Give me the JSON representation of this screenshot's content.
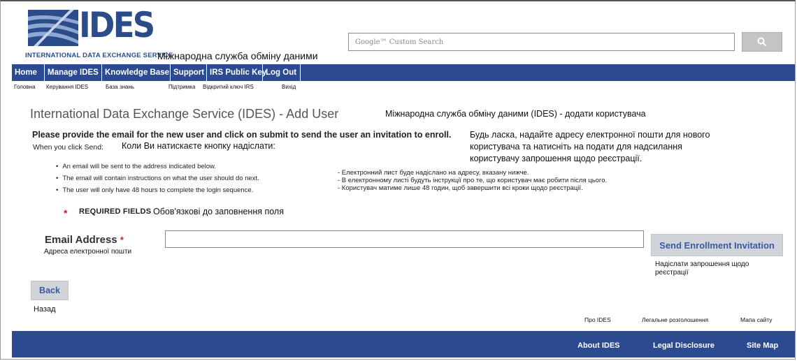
{
  "logo": {
    "big_text": "IDES",
    "sub_text": "INTERNATIONAL DATA EXCHANGE SERVICE",
    "uk_text": "Міжнародна служба обміну даними",
    "brand_color": "#2a4c8a"
  },
  "search": {
    "placeholder": "Google™ Custom Search",
    "button_icon": "search-icon"
  },
  "nav": {
    "items": [
      {
        "label": "Home",
        "uk": "Головна"
      },
      {
        "label": "Manage IDES",
        "uk": "Керування IDES"
      },
      {
        "label": "Knowledge Base",
        "uk": "База знань"
      },
      {
        "label": "Support",
        "uk": "Підтримка"
      },
      {
        "label": "IRS Public Key",
        "uk": "Відкритий ключ IRS"
      },
      {
        "label": "Log Out",
        "uk": "Вихід"
      }
    ],
    "bar_color": "#2b4a8f"
  },
  "page": {
    "title": "International Data Exchange Service (IDES) - Add User",
    "title_uk": "Міжнародна служба обміну даними (IDES) - додати користувача",
    "instruction": "Please provide the email for the new user and click on submit to send the user an invitation to enroll.",
    "instruction_uk": "Будь ласка, надайте адресу електронної пошти для нового користувача та натисніть на подати для надсилання користувачу запрошення щодо реєстрації.",
    "when_label": "When you click Send:",
    "when_uk": "Коли Ви натискаєте кнопку надіслати:",
    "bullets": [
      "An email will be sent to the address indicated below.",
      "The email will contain instructions on what the user should do next.",
      "The user will only have 48 hours to complete the login sequence."
    ],
    "bullets_uk": [
      "- Електронний лист буде надіслано на адресу, вказану нижче.",
      "- В електронному листі будуть інструкції про те, що користувач має робити після цього.",
      "- Користувач матиме лише 48 годин, щоб завершити всі кроки щодо реєстрації."
    ],
    "required_star": "*",
    "required_label": "REQUIRED FIELDS",
    "required_uk": "Обов'язкові до заповнення поля"
  },
  "form": {
    "email_label": "Email Address",
    "email_star": "*",
    "email_uk": "Адреса електронної пошти",
    "email_value": "",
    "send_label": "Send Enrollment Invitation",
    "send_uk": "Надіслати запрошення щодо реєстрації",
    "back_label": "Back",
    "back_uk": "Назад"
  },
  "footer": {
    "links": [
      "About IDES",
      "Legal Disclosure",
      "Site Map"
    ],
    "links_uk": [
      "Про IDES",
      "Легальне розголошення",
      "Мапа сайту"
    ]
  }
}
